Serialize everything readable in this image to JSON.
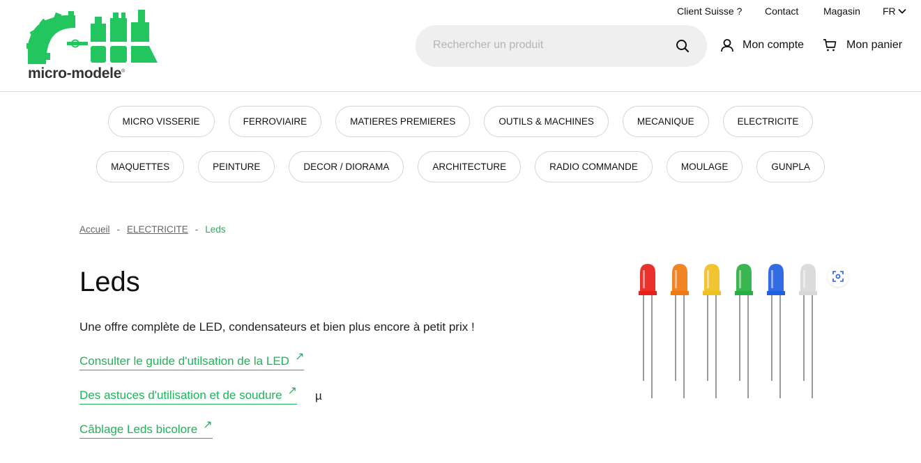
{
  "header": {
    "utility_links": [
      "Client Suisse ?",
      "Contact",
      "Magasin"
    ],
    "language": "FR",
    "logo_text": "micro-modele",
    "search": {
      "placeholder": "Rechercher un produit",
      "value": ""
    },
    "account_label": "Mon compte",
    "cart_label": "Mon panier"
  },
  "nav": {
    "row1": [
      "MICRO VISSERIE",
      "FERROVIAIRE",
      "MATIERES PREMIERES",
      "OUTILS & MACHINES",
      "MECANIQUE",
      "ELECTRICITE"
    ],
    "row2": [
      "MAQUETTES",
      "PEINTURE",
      "DECOR / DIORAMA",
      "ARCHITECTURE",
      "RADIO COMMANDE",
      "MOULAGE",
      "GUNPLA"
    ]
  },
  "breadcrumb": {
    "items": [
      "Accueil",
      "ELECTRICITE"
    ],
    "current": "Leds",
    "separator": "-"
  },
  "page": {
    "title": "Leds",
    "intro": "Une offre complète de LED, condensateurs et bien plus encore à petit prix !",
    "links": [
      "Consulter le guide d'utilsation de la LED",
      "Des astuces d'utilisation et de soudure",
      "Câblage Leds bicolore"
    ],
    "stray_text": "µ",
    "link_arrow": "↗"
  },
  "product_image": {
    "led_colors": [
      "#e8201a",
      "#f07a10",
      "#f0c020",
      "#28b040",
      "#1f5fe0",
      "#d8d8d8"
    ]
  },
  "colors": {
    "accent": "#20b25a",
    "logo_green": "#22c55e",
    "search_bg": "#efefef"
  },
  "icons": [
    "search-icon",
    "user-icon",
    "cart-icon",
    "chevron-down-icon",
    "zoom-icon",
    "external-arrow-icon"
  ]
}
